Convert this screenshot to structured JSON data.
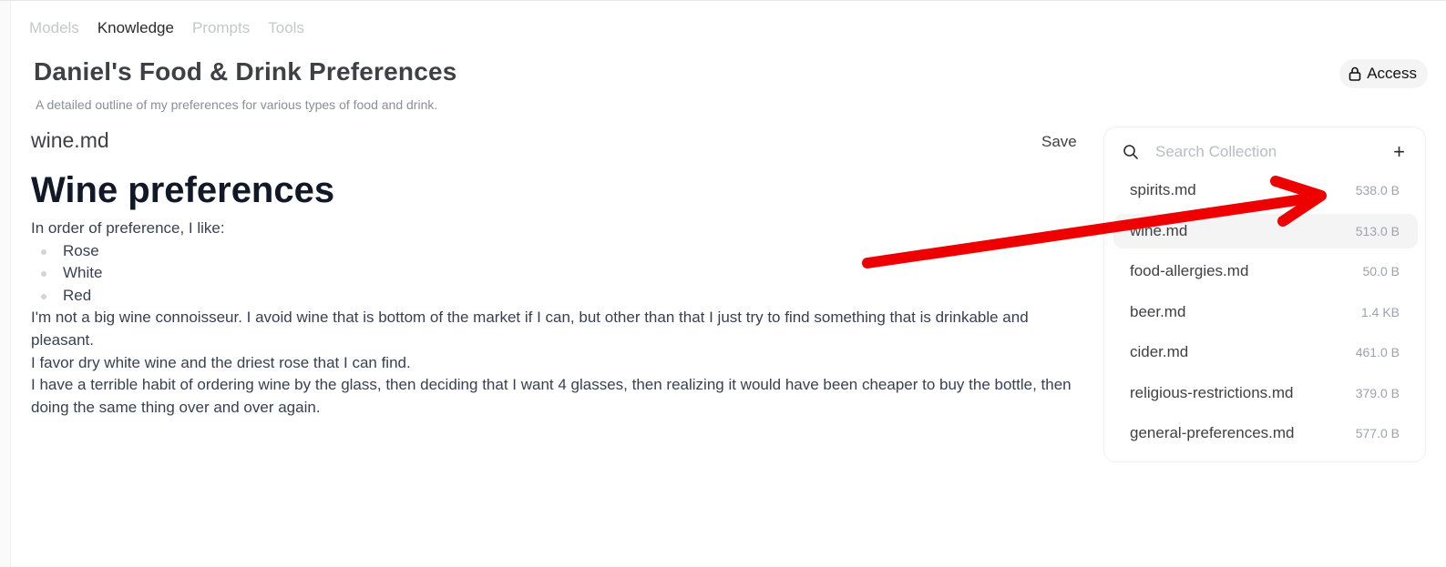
{
  "tabs": [
    {
      "label": "Models",
      "active": false
    },
    {
      "label": "Knowledge",
      "active": true
    },
    {
      "label": "Prompts",
      "active": false
    },
    {
      "label": "Tools",
      "active": false
    }
  ],
  "collection": {
    "title": "Daniel's Food & Drink Preferences",
    "description": "A detailed outline of my preferences for various types of food and drink.",
    "access_label": "Access"
  },
  "document": {
    "filename": "wine.md",
    "save_label": "Save",
    "heading": "Wine preferences",
    "intro": "In order of preference, I like:",
    "list": [
      "Rose",
      "White",
      "Red"
    ],
    "paragraphs": [
      "I'm not a big wine connoisseur. I avoid wine that is bottom of the market if I can, but other than that I just try to find something that is drinkable and pleasant.",
      "I favor dry white wine and the driest rose that I can find.",
      "I have a terrible habit of ordering wine by the glass, then deciding that I want 4 glasses, then realizing it would have been cheaper to buy the bottle, then doing the same thing over and over again."
    ]
  },
  "panel": {
    "search_placeholder": "Search Collection",
    "add_label": "+",
    "files": [
      {
        "name": "spirits.md",
        "size": "538.0 B"
      },
      {
        "name": "wine.md",
        "size": "513.0 B",
        "selected": true
      },
      {
        "name": "food-allergies.md",
        "size": "50.0 B"
      },
      {
        "name": "beer.md",
        "size": "1.4 KB"
      },
      {
        "name": "cider.md",
        "size": "461.0 B"
      },
      {
        "name": "religious-restrictions.md",
        "size": "379.0 B"
      },
      {
        "name": "general-preferences.md",
        "size": "577.0 B"
      }
    ]
  },
  "colors": {
    "annotation_arrow": "#ee0000",
    "selected_row": "#f4f4f5",
    "active_tab": "#2b2b2b",
    "inactive_tab": "#c4c7cc"
  },
  "icons": {
    "access": "lock-icon",
    "search": "search-icon",
    "add": "plus-icon",
    "annotation": "arrow-icon"
  }
}
